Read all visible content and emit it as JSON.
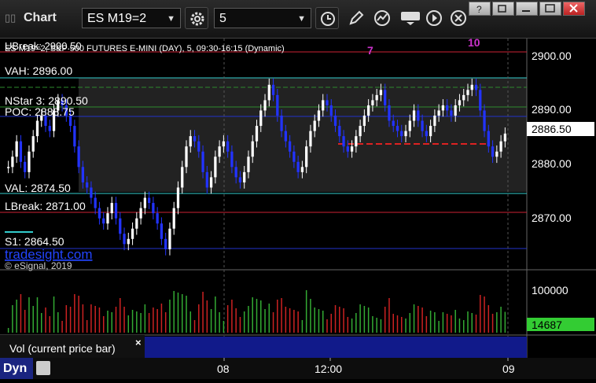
{
  "toolbar": {
    "title": "Chart",
    "symbol": "ES M19=2",
    "interval": "5"
  },
  "chart_header": {
    "description": "ES M19=2, S&P 500 FUTURES E-MINI (DAY), 5, 09:30-16:15 (Dynamic)"
  },
  "levels": {
    "ubreak": "UBreak: 2900.50",
    "vah": "VAH: 2896.00",
    "nstar": "NStar 3: 2890.50",
    "poc": "POC: 2888.75",
    "val": "VAL: 2874.50",
    "lbreak": "LBreak: 2871.00",
    "s1": "S1: 2864.50"
  },
  "branding": {
    "site": "tradesight.com",
    "copyright": "© eSignal, 2019"
  },
  "price_axis": {
    "ticks": [
      "2900.00",
      "2890.00",
      "2880.00",
      "2870.00"
    ],
    "current": "2886.50"
  },
  "volume_axis": {
    "tick": "100000",
    "current": "14687"
  },
  "time_axis": {
    "ticks": [
      "08",
      "12:00",
      "09"
    ]
  },
  "study_label": "Vol (current price bar)",
  "footer": {
    "dyn_label": "Dyn"
  },
  "annotations": [
    "7",
    "10"
  ],
  "colors": {
    "accent_magenta": "#cc33cc",
    "blue_bars": "#2233ff",
    "white_bars": "#ffffff",
    "green_counts": "#33aa33",
    "volume_current": "#33cc33"
  },
  "chart_data": {
    "type": "candlestick",
    "title": "ES M19=2, S&P 500 FUTURES E-MINI (DAY), 5, 09:30-16:15 (Dynamic)",
    "ylim": [
      2860,
      2905
    ],
    "yticks": [
      2900,
      2890,
      2880,
      2870
    ],
    "x_tick_labels": [
      "08",
      "12:00",
      "09"
    ],
    "last_price": 2886.5,
    "levels": [
      {
        "name": "UBreak",
        "value": 2900.5
      },
      {
        "name": "VAH",
        "value": 2896.0
      },
      {
        "name": "NStar 3",
        "value": 2890.5
      },
      {
        "name": "POC",
        "value": 2888.75
      },
      {
        "name": "VAL",
        "value": 2874.5
      },
      {
        "name": "LBreak",
        "value": 2871.0
      },
      {
        "name": "S1",
        "value": 2864.5
      }
    ],
    "close_series": [
      2880,
      2882,
      2885,
      2881,
      2879,
      2883,
      2886,
      2889,
      2890,
      2888,
      2887,
      2891,
      2893,
      2892,
      2890,
      2888,
      2884,
      2880,
      2877,
      2876,
      2874,
      2872,
      2870,
      2869,
      2871,
      2873,
      2870,
      2867,
      2865,
      2866,
      2868,
      2870,
      2872,
      2874,
      2873,
      2871,
      2869,
      2866,
      2864,
      2868,
      2872,
      2876,
      2880,
      2884,
      2886,
      2885,
      2883,
      2879,
      2876,
      2878,
      2882,
      2884,
      2885,
      2883,
      2880,
      2878,
      2877,
      2879,
      2882,
      2885,
      2888,
      2891,
      2893,
      2896,
      2894,
      2890,
      2887,
      2885,
      2883,
      2881,
      2879,
      2880,
      2884,
      2887,
      2889,
      2891,
      2893,
      2892,
      2890,
      2888,
      2886,
      2884,
      2883,
      2884,
      2886,
      2888,
      2890,
      2892,
      2893,
      2894,
      2895,
      2892,
      2889,
      2888,
      2887,
      2886,
      2887,
      2889,
      2891,
      2889,
      2887,
      2886,
      2888,
      2890,
      2891,
      2892,
      2891,
      2890,
      2892,
      2893,
      2894,
      2895,
      2896,
      2895,
      2891,
      2887,
      2884,
      2882,
      2883,
      2885,
      2886.5
    ],
    "volume_max_tick": 100000,
    "volume_current": 14687
  }
}
